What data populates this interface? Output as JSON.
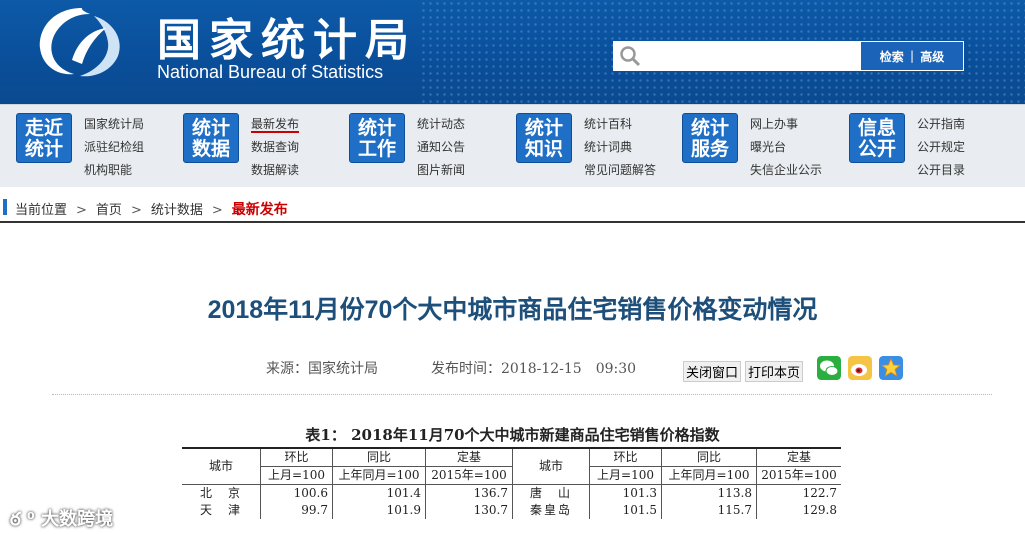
{
  "header": {
    "title": "国家统计局",
    "subtitle": "National Bureau of Statistics",
    "search": {
      "placeholder": "",
      "search_label": "检索",
      "advanced_label": "高级"
    }
  },
  "nav": [
    {
      "badge": [
        "走近",
        "统计"
      ],
      "links": [
        "国家统计局",
        "派驻纪检组",
        "机构职能"
      ]
    },
    {
      "badge": [
        "统计",
        "数据"
      ],
      "links": [
        "最新发布",
        "数据查询",
        "数据解读"
      ]
    },
    {
      "badge": [
        "统计",
        "工作"
      ],
      "links": [
        "统计动态",
        "通知公告",
        "图片新闻"
      ]
    },
    {
      "badge": [
        "统计",
        "知识"
      ],
      "links": [
        "统计百科",
        "统计词典",
        "常见问题解答"
      ]
    },
    {
      "badge": [
        "统计",
        "服务"
      ],
      "links": [
        "网上办事",
        "曝光台",
        "失信企业公示"
      ]
    },
    {
      "badge": [
        "信息",
        "公开"
      ],
      "links": [
        "公开指南",
        "公开规定",
        "公开目录"
      ]
    }
  ],
  "breadcrumb": {
    "label": "当前位置",
    "items": [
      "首页",
      "统计数据"
    ],
    "current": "最新发布"
  },
  "article": {
    "title": "2018年11月份70个大中城市商品住宅销售价格变动情况",
    "source": "来源：国家统计局",
    "published": "发布时间：2018-12-15　09:30",
    "close_label": "关闭窗口",
    "print_label": "打印本页"
  },
  "table": {
    "caption": "表1：  2018年11月70个大中城市新建商品住宅销售价格指数",
    "headers": {
      "city": "城市",
      "mom": "环比",
      "yoy": "同比",
      "base": "定基"
    },
    "subheaders": {
      "mom": "上月=100",
      "yoy": "上年同月=100",
      "base": "2015年=100"
    },
    "rows": [
      {
        "left": [
          "北　京",
          "100.6",
          "101.4",
          "136.7"
        ],
        "right": [
          "唐　山",
          "101.3",
          "113.8",
          "122.7"
        ]
      },
      {
        "left": [
          "天　津",
          "99.7",
          "101.9",
          "130.7"
        ],
        "right": [
          "秦皇岛",
          "101.5",
          "115.7",
          "129.8"
        ]
      }
    ]
  },
  "watermark": "大数跨境",
  "colors": {
    "header_blue": "#0a4f9b",
    "title_blue": "#1d4f7a",
    "current_red": "#cc0000"
  }
}
